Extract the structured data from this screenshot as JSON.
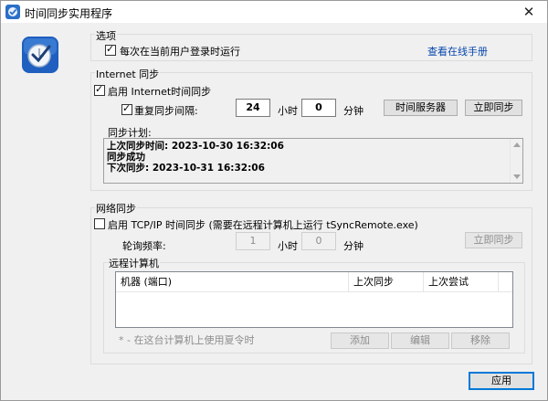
{
  "window": {
    "title": "时间同步实用程序"
  },
  "options": {
    "title": "选项",
    "run_at_login_label": "每次在当前用户登录时运行",
    "run_at_login_checked": true,
    "manual_link": "查看在线手册"
  },
  "internet_sync": {
    "title": "Internet 同步",
    "enable_label": "启用 Internet时间同步",
    "enable_checked": true,
    "repeat_label": "重复同步间隔:",
    "repeat_checked": true,
    "hours_value": "24",
    "hours_unit": "小时",
    "minutes_value": "0",
    "minutes_unit": "分钟",
    "time_server_button": "时间服务器",
    "sync_now_button": "立即同步",
    "schedule_label": "同步计划:",
    "log_lines": [
      "上次同步时间: 2023-10-30 16:32:06",
      "同步成功",
      "下次同步: 2023-10-31 16:32:06"
    ]
  },
  "network_sync": {
    "title": "网络同步",
    "enable_label": "启用 TCP/IP 时间同步 (需要在远程计算机上运行 tSyncRemote.exe)",
    "enable_checked": false,
    "poll_label": "轮询频率:",
    "hours_value": "1",
    "hours_unit": "小时",
    "minutes_value": "0",
    "minutes_unit": "分钟",
    "sync_now_button": "立即同步",
    "remote_title": "远程计算机",
    "columns": [
      "机器 (端口)",
      "上次同步",
      "上次尝试"
    ],
    "footnote": "* - 在这台计算机上使用夏令时",
    "add_button": "添加",
    "edit_button": "编辑",
    "remove_button": "移除"
  },
  "apply_button": "应用",
  "colors": {
    "accent": "#0078d7",
    "link": "#0645ad",
    "disabled": "#8d8d8d"
  },
  "icons": [
    "app-clock-check-icon",
    "close-icon"
  ]
}
